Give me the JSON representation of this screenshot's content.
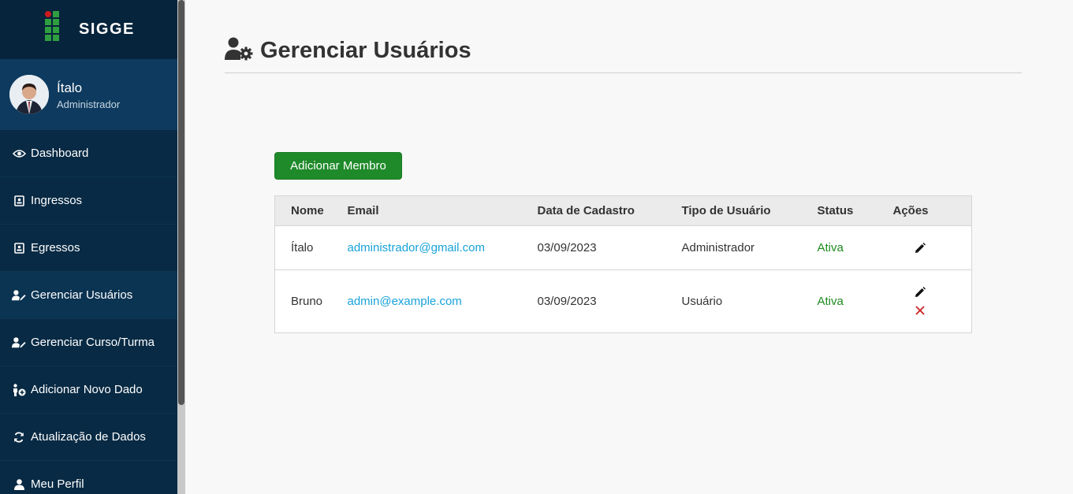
{
  "app": {
    "name": "SIGGE"
  },
  "profile": {
    "name": "Ítalo",
    "role": "Administrador"
  },
  "nav": [
    {
      "label": "Dashboard",
      "icon": "eye-icon"
    },
    {
      "label": "Ingressos",
      "icon": "id-card-icon"
    },
    {
      "label": "Egressos",
      "icon": "id-card-icon"
    },
    {
      "label": "Gerenciar Usuários",
      "icon": "user-edit-icon"
    },
    {
      "label": "Gerenciar Curso/Turma",
      "icon": "user-edit-icon"
    },
    {
      "label": "Adicionar Novo Dado",
      "icon": "person-add-icon"
    },
    {
      "label": "Atualização de Dados",
      "icon": "refresh-icon"
    },
    {
      "label": "Meu Perfil",
      "icon": "user-icon"
    }
  ],
  "page": {
    "title": "Gerenciar Usuários",
    "add_button": "Adicionar Membro"
  },
  "table": {
    "headers": [
      "Nome",
      "Email",
      "Data de Cadastro",
      "Tipo de Usuário",
      "Status",
      "Ações"
    ],
    "rows": [
      {
        "nome": "Ítalo",
        "email": "administrador@gmail.com",
        "data": "03/09/2023",
        "tipo": "Administrador",
        "status": "Ativa",
        "actions": [
          "edit"
        ]
      },
      {
        "nome": "Bruno",
        "email": "admin@example.com",
        "data": "03/09/2023",
        "tipo": "Usuário",
        "status": "Ativa",
        "actions": [
          "edit",
          "delete"
        ]
      }
    ]
  },
  "colors": {
    "sidebar": "#082a44",
    "accent_green": "#1f8a2a",
    "link": "#17a2d8",
    "status_active": "#1e8a1e",
    "delete": "#cc2222"
  }
}
